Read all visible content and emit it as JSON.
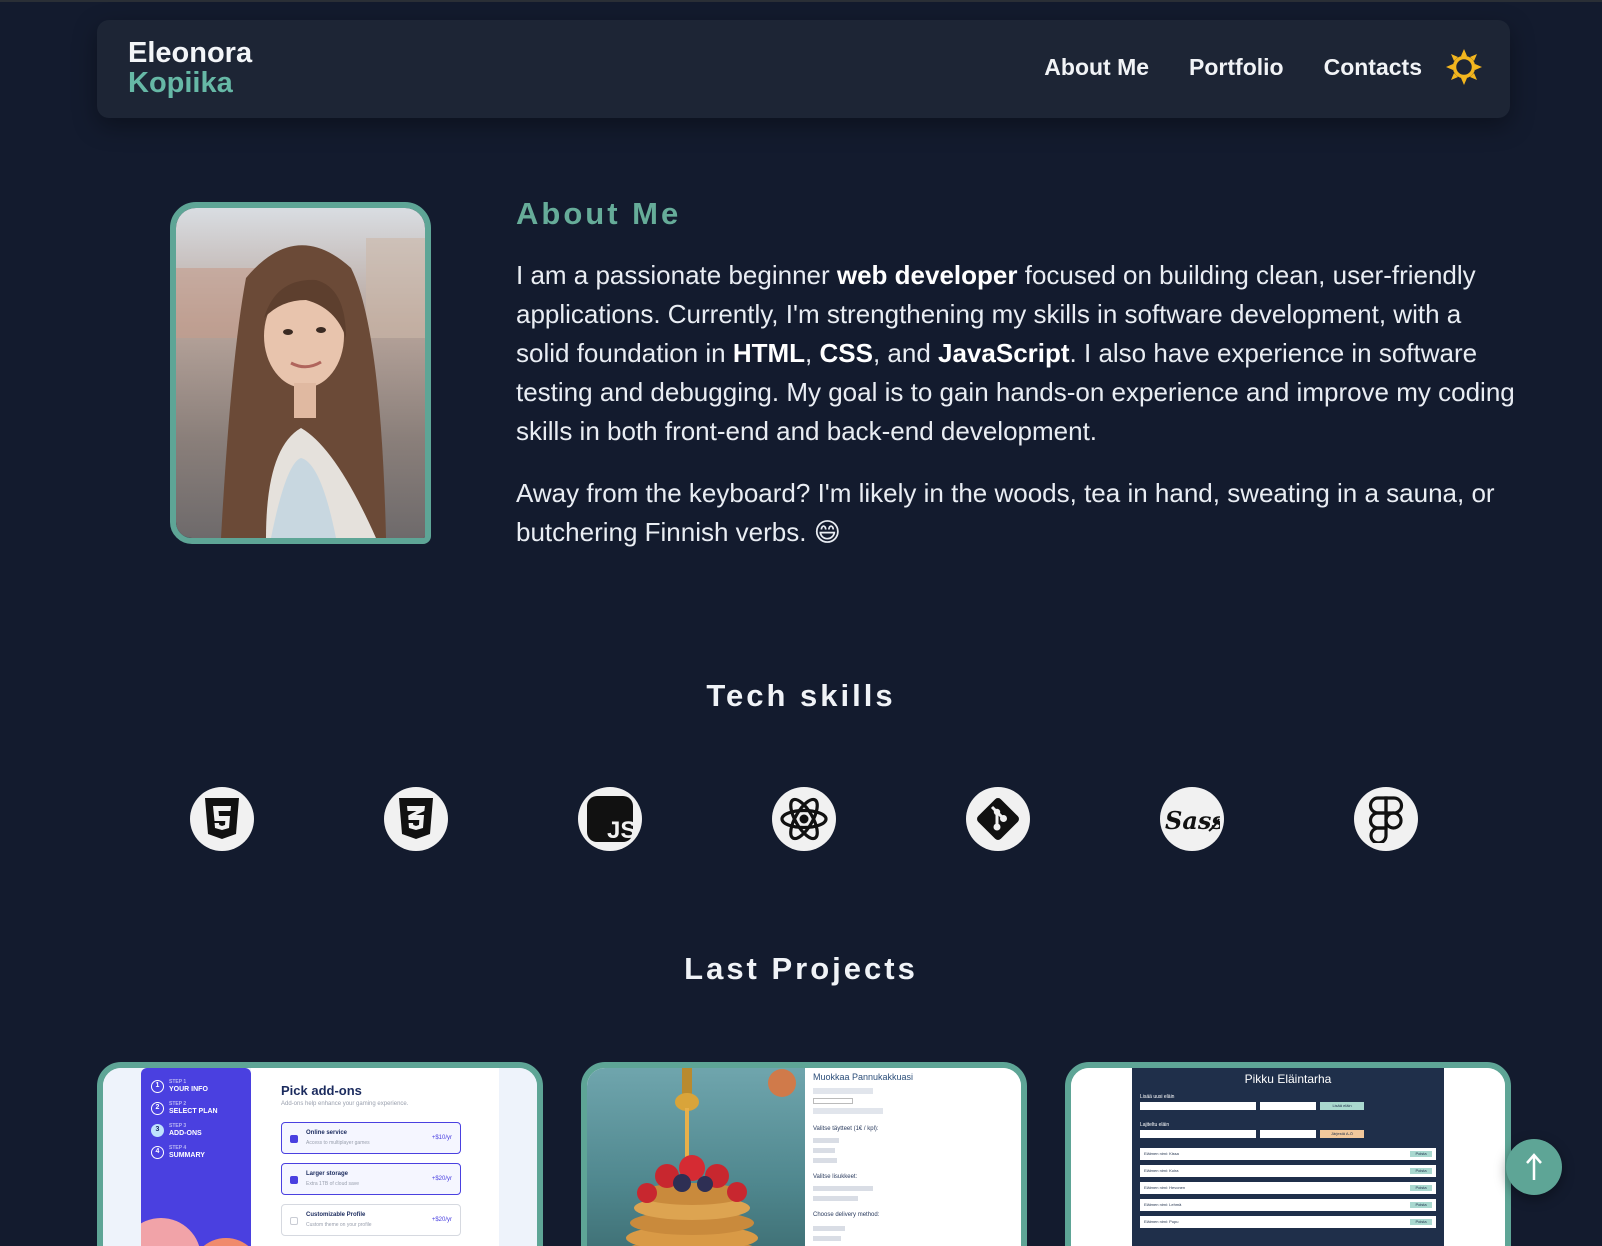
{
  "header": {
    "logo_first": "Eleonora",
    "logo_last": "Kopiika",
    "nav": [
      {
        "label": "About Me"
      },
      {
        "label": "Portfolio"
      },
      {
        "label": "Contacts"
      }
    ],
    "theme_icon": "sun-icon"
  },
  "about": {
    "title": "About Me",
    "p1": {
      "t1": "I am a passionate beginner ",
      "b1": "web developer",
      "t2": " focused on building clean, user-friendly applications. Currently, I'm strengthening my skills in software development, with a solid foundation in ",
      "b2": "HTML",
      "t3": ", ",
      "b3": "CSS",
      "t4": ", and ",
      "b4": "JavaScript",
      "t5": ". I also have experience in software testing and debugging. My goal is to gain hands-on experience and improve my coding skills in both front-end and back-end development."
    },
    "p2": "Away from the keyboard? I'm likely in the woods, tea in hand, sweating in a sauna, or butchering Finnish verbs. 😄"
  },
  "skills": {
    "title": "Tech skills",
    "icons": [
      "html5-icon",
      "css3-icon",
      "javascript-icon",
      "react-icon",
      "git-icon",
      "sass-icon",
      "figma-icon"
    ],
    "js_text": "JS",
    "sass_text": "Sass"
  },
  "projects": {
    "title": "Last Projects",
    "p1": {
      "steps": [
        {
          "num": "1",
          "step": "STEP 1",
          "name": "YOUR INFO"
        },
        {
          "num": "2",
          "step": "STEP 2",
          "name": "SELECT PLAN"
        },
        {
          "num": "3",
          "step": "STEP 3",
          "name": "ADD-ONS"
        },
        {
          "num": "4",
          "step": "STEP 4",
          "name": "SUMMARY"
        }
      ],
      "heading": "Pick add-ons",
      "sub": "Add-ons help enhance your gaming experience.",
      "addons": [
        {
          "name": "Online service",
          "desc": "Access to multiplayer games",
          "price": "+$10/yr"
        },
        {
          "name": "Larger storage",
          "desc": "Extra 1TB of cloud save",
          "price": "+$20/yr"
        },
        {
          "name": "Customizable Profile",
          "desc": "Custom theme on your profile",
          "price": "+$20/yr"
        }
      ]
    },
    "p2": {
      "heading": "Muokkaa Pannukakkuasi",
      "labels": [
        "Valitse täytteet (1€ / kpl):",
        "Valitse lisukkeet:",
        "Choose delivery method:"
      ]
    },
    "p3": {
      "heading": "Pikku Eläintarha",
      "section1": "Lisää uusi eläin",
      "section2": "Lajiteltu eläin",
      "btn1": "Lisää eläin",
      "btn2": "Järjestä A-Ö",
      "rows": [
        "Eläimen nimi: Kissa",
        "Eläimen nimi: Koira",
        "Eläimen nimi: Hevonen",
        "Eläimen nimi: Lehmä",
        "Eläimen nimi: Pupu"
      ],
      "row_btn": "Poista"
    }
  }
}
